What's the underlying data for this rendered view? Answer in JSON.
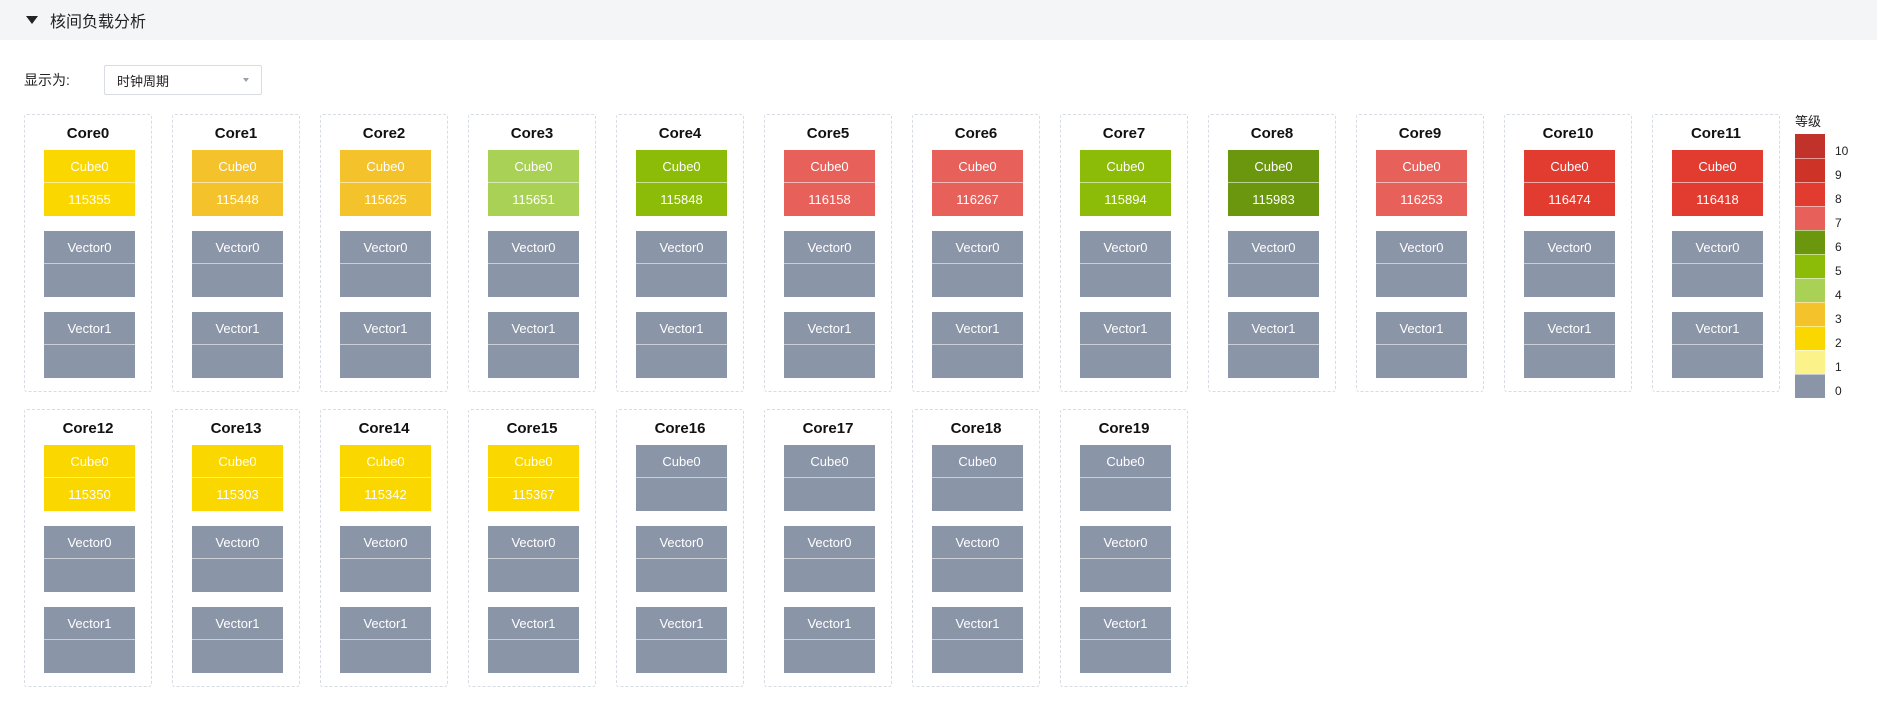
{
  "section": {
    "title": "核间负载分析"
  },
  "toolbar": {
    "display_label": "显示为:",
    "select_value": "时钟周期"
  },
  "legend": {
    "title": "等级",
    "levels": [
      {
        "label": "10",
        "color": "#c0322a"
      },
      {
        "label": "9",
        "color": "#cd3327"
      },
      {
        "label": "8",
        "color": "#e23b30"
      },
      {
        "label": "7",
        "color": "#e8605a"
      },
      {
        "label": "6",
        "color": "#6a970d"
      },
      {
        "label": "5",
        "color": "#8cbc07"
      },
      {
        "label": "4",
        "color": "#a8d155"
      },
      {
        "label": "3",
        "color": "#f4c32b"
      },
      {
        "label": "2",
        "color": "#fbd700"
      },
      {
        "label": "1",
        "color": "#fbf28a"
      },
      {
        "label": "0",
        "color": "#8b95a8"
      }
    ]
  },
  "cores": [
    {
      "name": "Core0",
      "cube": {
        "label": "Cube0",
        "value": "115355",
        "level": 2
      },
      "vector0": {
        "label": "Vector0",
        "value": "",
        "level": 0
      },
      "vector1": {
        "label": "Vector1",
        "value": "",
        "level": 0
      }
    },
    {
      "name": "Core1",
      "cube": {
        "label": "Cube0",
        "value": "115448",
        "level": 3
      },
      "vector0": {
        "label": "Vector0",
        "value": "",
        "level": 0
      },
      "vector1": {
        "label": "Vector1",
        "value": "",
        "level": 0
      }
    },
    {
      "name": "Core2",
      "cube": {
        "label": "Cube0",
        "value": "115625",
        "level": 3
      },
      "vector0": {
        "label": "Vector0",
        "value": "",
        "level": 0
      },
      "vector1": {
        "label": "Vector1",
        "value": "",
        "level": 0
      }
    },
    {
      "name": "Core3",
      "cube": {
        "label": "Cube0",
        "value": "115651",
        "level": 4
      },
      "vector0": {
        "label": "Vector0",
        "value": "",
        "level": 0
      },
      "vector1": {
        "label": "Vector1",
        "value": "",
        "level": 0
      }
    },
    {
      "name": "Core4",
      "cube": {
        "label": "Cube0",
        "value": "115848",
        "level": 5
      },
      "vector0": {
        "label": "Vector0",
        "value": "",
        "level": 0
      },
      "vector1": {
        "label": "Vector1",
        "value": "",
        "level": 0
      }
    },
    {
      "name": "Core5",
      "cube": {
        "label": "Cube0",
        "value": "116158",
        "level": 7
      },
      "vector0": {
        "label": "Vector0",
        "value": "",
        "level": 0
      },
      "vector1": {
        "label": "Vector1",
        "value": "",
        "level": 0
      }
    },
    {
      "name": "Core6",
      "cube": {
        "label": "Cube0",
        "value": "116267",
        "level": 7
      },
      "vector0": {
        "label": "Vector0",
        "value": "",
        "level": 0
      },
      "vector1": {
        "label": "Vector1",
        "value": "",
        "level": 0
      }
    },
    {
      "name": "Core7",
      "cube": {
        "label": "Cube0",
        "value": "115894",
        "level": 5
      },
      "vector0": {
        "label": "Vector0",
        "value": "",
        "level": 0
      },
      "vector1": {
        "label": "Vector1",
        "value": "",
        "level": 0
      }
    },
    {
      "name": "Core8",
      "cube": {
        "label": "Cube0",
        "value": "115983",
        "level": 6
      },
      "vector0": {
        "label": "Vector0",
        "value": "",
        "level": 0
      },
      "vector1": {
        "label": "Vector1",
        "value": "",
        "level": 0
      }
    },
    {
      "name": "Core9",
      "cube": {
        "label": "Cube0",
        "value": "116253",
        "level": 7
      },
      "vector0": {
        "label": "Vector0",
        "value": "",
        "level": 0
      },
      "vector1": {
        "label": "Vector1",
        "value": "",
        "level": 0
      }
    },
    {
      "name": "Core10",
      "cube": {
        "label": "Cube0",
        "value": "116474",
        "level": 8
      },
      "vector0": {
        "label": "Vector0",
        "value": "",
        "level": 0
      },
      "vector1": {
        "label": "Vector1",
        "value": "",
        "level": 0
      }
    },
    {
      "name": "Core11",
      "cube": {
        "label": "Cube0",
        "value": "116418",
        "level": 8
      },
      "vector0": {
        "label": "Vector0",
        "value": "",
        "level": 0
      },
      "vector1": {
        "label": "Vector1",
        "value": "",
        "level": 0
      }
    },
    {
      "name": "Core12",
      "cube": {
        "label": "Cube0",
        "value": "115350",
        "level": 2
      },
      "vector0": {
        "label": "Vector0",
        "value": "",
        "level": 0
      },
      "vector1": {
        "label": "Vector1",
        "value": "",
        "level": 0
      }
    },
    {
      "name": "Core13",
      "cube": {
        "label": "Cube0",
        "value": "115303",
        "level": 2
      },
      "vector0": {
        "label": "Vector0",
        "value": "",
        "level": 0
      },
      "vector1": {
        "label": "Vector1",
        "value": "",
        "level": 0
      }
    },
    {
      "name": "Core14",
      "cube": {
        "label": "Cube0",
        "value": "115342",
        "level": 2
      },
      "vector0": {
        "label": "Vector0",
        "value": "",
        "level": 0
      },
      "vector1": {
        "label": "Vector1",
        "value": "",
        "level": 0
      }
    },
    {
      "name": "Core15",
      "cube": {
        "label": "Cube0",
        "value": "115367",
        "level": 2
      },
      "vector0": {
        "label": "Vector0",
        "value": "",
        "level": 0
      },
      "vector1": {
        "label": "Vector1",
        "value": "",
        "level": 0
      }
    },
    {
      "name": "Core16",
      "cube": {
        "label": "Cube0",
        "value": "",
        "level": 0
      },
      "vector0": {
        "label": "Vector0",
        "value": "",
        "level": 0
      },
      "vector1": {
        "label": "Vector1",
        "value": "",
        "level": 0
      }
    },
    {
      "name": "Core17",
      "cube": {
        "label": "Cube0",
        "value": "",
        "level": 0
      },
      "vector0": {
        "label": "Vector0",
        "value": "",
        "level": 0
      },
      "vector1": {
        "label": "Vector1",
        "value": "",
        "level": 0
      }
    },
    {
      "name": "Core18",
      "cube": {
        "label": "Cube0",
        "value": "",
        "level": 0
      },
      "vector0": {
        "label": "Vector0",
        "value": "",
        "level": 0
      },
      "vector1": {
        "label": "Vector1",
        "value": "",
        "level": 0
      }
    },
    {
      "name": "Core19",
      "cube": {
        "label": "Cube0",
        "value": "",
        "level": 0
      },
      "vector0": {
        "label": "Vector0",
        "value": "",
        "level": 0
      },
      "vector1": {
        "label": "Vector1",
        "value": "",
        "level": 0
      }
    }
  ]
}
